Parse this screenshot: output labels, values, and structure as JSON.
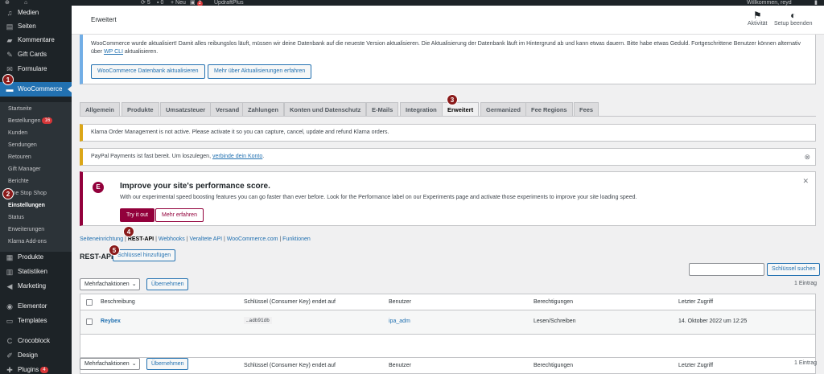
{
  "adminbar": {
    "updates_count": "5",
    "comments_count": "0",
    "new_label": "Neu",
    "plugin_badge": "2",
    "plugin_name": "UpdraftPlus",
    "greeting": "Willkommen, reyd"
  },
  "sidebar": {
    "top_items": [
      {
        "label": "Medien",
        "icon": "media-icon"
      },
      {
        "label": "Seiten",
        "icon": "pages-icon"
      },
      {
        "label": "Kommentare",
        "icon": "comments-icon"
      },
      {
        "label": "Gift Cards",
        "icon": "gift-cards-icon"
      },
      {
        "label": "Formulare",
        "icon": "forms-icon"
      }
    ],
    "woocommerce": "WooCommerce",
    "submenu": [
      {
        "label": "Startseite"
      },
      {
        "label": "Bestellungen",
        "badge": "16"
      },
      {
        "label": "Kunden"
      },
      {
        "label": "Sendungen"
      },
      {
        "label": "Retouren"
      },
      {
        "label": "Gift Manager"
      },
      {
        "label": "Berichte"
      },
      {
        "label": "One Stop Shop"
      },
      {
        "label": "Einstellungen"
      },
      {
        "label": "Status"
      },
      {
        "label": "Erweiterungen"
      },
      {
        "label": "Klarna Add-ons"
      }
    ],
    "bottom_items": [
      {
        "label": "Produkte",
        "icon": "products-icon"
      },
      {
        "label": "Statistiken",
        "icon": "analytics-icon"
      },
      {
        "label": "Marketing",
        "icon": "marketing-icon"
      },
      {
        "label": "Elementor",
        "icon": "elementor-icon"
      },
      {
        "label": "Templates",
        "icon": "templates-icon"
      },
      {
        "label": "Crocoblock",
        "icon": "crocoblock-icon"
      },
      {
        "label": "Design",
        "icon": "design-icon"
      },
      {
        "label": "Plugins",
        "icon": "plugins-icon",
        "badge": "4"
      }
    ]
  },
  "steps": [
    "1",
    "2",
    "3",
    "4",
    "5"
  ],
  "header": {
    "title": "Erweitert",
    "activity_label": "Aktivität",
    "setup_label": "Setup beenden"
  },
  "notice_update": {
    "text": "WooCommerce wurde aktualisiert! Damit alles reibungslos läuft, müssen wir deine Datenbank auf die neueste Version aktualisieren. Die Aktualisierung der Datenbank läuft im Hintergrund ab und kann etwas dauern. Bitte habe etwas Geduld. Fortgeschrittene Benutzer können alternativ über",
    "link": "WP CLI",
    "text_after": "aktualisieren.",
    "button_update": "WooCommerce Datenbank aktualisieren",
    "button_more": "Mehr über Aktualisierungen erfahren"
  },
  "tabs": [
    "Allgemein",
    "Produkte",
    "Umsatzsteuer",
    "Versand",
    "Zahlungen",
    "Konten und Datenschutz",
    "E-Mails",
    "Integration",
    "Erweitert",
    "Germanized",
    "Fee Regions",
    "Fees"
  ],
  "notice_klarna": "Klarna Order Management is not active. Please activate it so you can capture, cancel, update and refund Klarna orders.",
  "notice_paypal": {
    "text": "PayPal Payments ist fast bereit. Um loszulegen,",
    "link": "verbinde dein Konto",
    "end": "."
  },
  "promo": {
    "title": "Improve your site's performance score.",
    "text": "With our experimental speed boosting features you can go faster than ever before. Look for the Performance label on our Experiments page and activate those experiments to improve your site loading speed.",
    "try_label": "Try it out",
    "more_label": "Mehr erfahren"
  },
  "subnav": {
    "items": [
      "Seiteneinrichtung",
      "REST-API",
      "Webhooks",
      "Veraltete API",
      "WooCommerce.com",
      "Funktionen"
    ],
    "separator": "|"
  },
  "rest": {
    "heading": "REST-API",
    "add_key": "Schlüssel hinzufügen",
    "search_button": "Schlüssel suchen",
    "bulk_label": "Mehrfachaktionen",
    "apply_label": "Übernehmen",
    "count": "1 Eintrag",
    "columns": [
      "Beschreibung",
      "Schlüssel (Consumer Key) endet auf",
      "Benutzer",
      "Berechtigungen",
      "Letzter Zugriff"
    ],
    "row": {
      "description": "Reybex",
      "key": "…adb91db",
      "user": "ipa_adm",
      "permissions": "Lesen/Schreiben",
      "last_access": "14. Oktober 2022 um 12:25"
    }
  },
  "colors": {
    "accent": "#2271b1",
    "sidebar": "#1d2327",
    "elementor": "#92003b",
    "step": "#8a1a1a"
  }
}
